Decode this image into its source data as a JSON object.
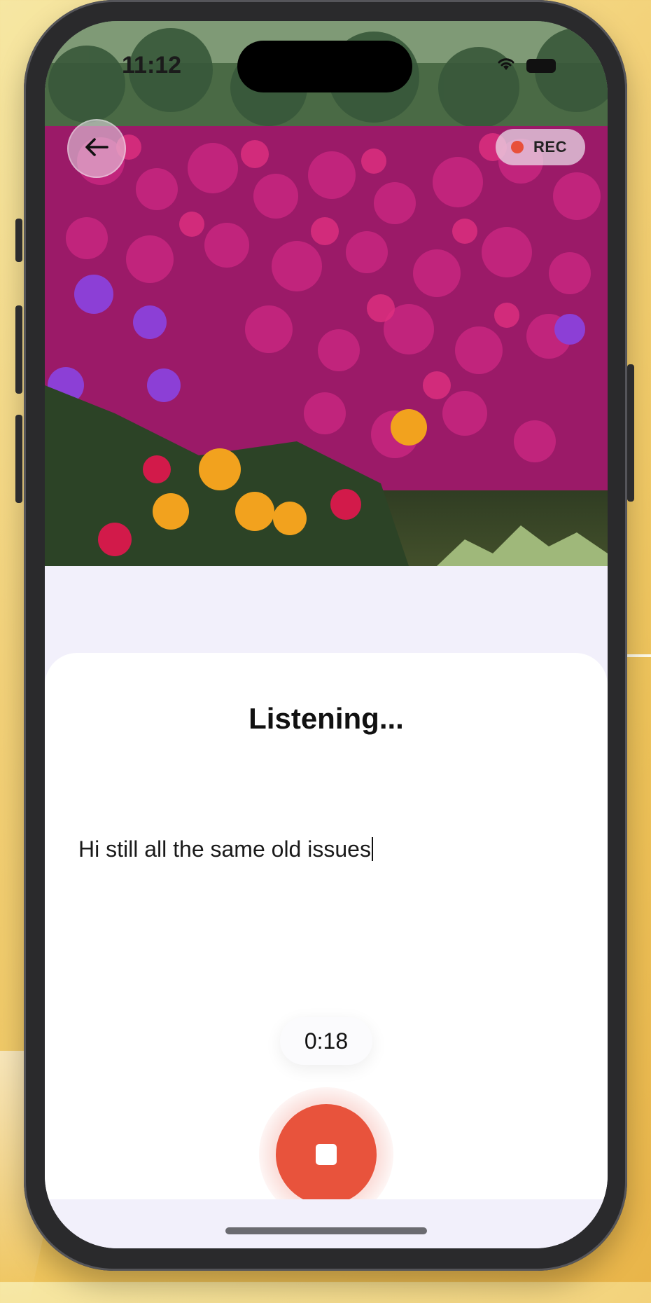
{
  "status_bar": {
    "time": "11:12",
    "wifi_icon": "wifi-icon",
    "battery_icon": "battery-icon"
  },
  "header": {
    "back_icon": "arrow-left-icon",
    "rec_label": "REC"
  },
  "photo": {
    "subject": "field of magenta, purple and yellow ice plant flowers"
  },
  "sheet": {
    "title": "Listening...",
    "transcript": "Hi still all the same old issues",
    "timer": "0:18",
    "stop_icon": "stop-icon"
  },
  "colors": {
    "record_red": "#e8533c",
    "sheet_bg": "#ffffff",
    "band_bg": "#f2f0fb"
  }
}
